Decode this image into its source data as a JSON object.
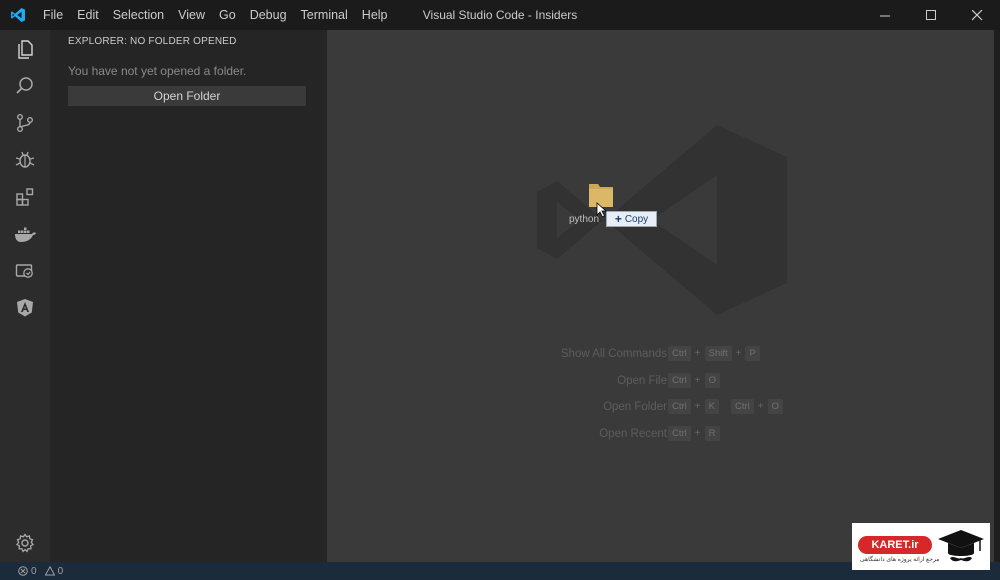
{
  "titlebar": {
    "menu": [
      "File",
      "Edit",
      "Selection",
      "View",
      "Go",
      "Debug",
      "Terminal",
      "Help"
    ],
    "title": "Visual Studio Code - Insiders"
  },
  "activitybar": {
    "icons": [
      "files-icon",
      "search-icon",
      "source-control-icon",
      "debug-icon",
      "extensions-icon",
      "docker-icon",
      "remote-icon",
      "angular-icon",
      "settings-gear-icon"
    ]
  },
  "sidebar": {
    "title": "EXPLORER: NO FOLDER OPENED",
    "message": "You have not yet opened a folder.",
    "button": "Open Folder"
  },
  "editor": {
    "shortcuts": [
      {
        "label": "Show All Commands",
        "keys": [
          [
            "Ctrl",
            "Shift",
            "P"
          ]
        ]
      },
      {
        "label": "Open File",
        "keys": [
          [
            "Ctrl",
            "O"
          ]
        ]
      },
      {
        "label": "Open Folder",
        "keys": [
          [
            "Ctrl",
            "K"
          ],
          [
            "Ctrl",
            "O"
          ]
        ]
      },
      {
        "label": "Open Recent",
        "keys": [
          [
            "Ctrl",
            "R"
          ]
        ]
      }
    ],
    "drag": {
      "folder_name": "python",
      "tooltip": "Copy"
    }
  },
  "statusbar": {
    "errors": "0",
    "warnings": "0"
  },
  "badge": {
    "brand": "KARET.ir",
    "subtitle": "مرجع ارائه پروژه های دانشگاهی"
  },
  "colors": {
    "accent": "#23a9f2",
    "folder": "#dcb767",
    "badge_red": "#d62828"
  }
}
